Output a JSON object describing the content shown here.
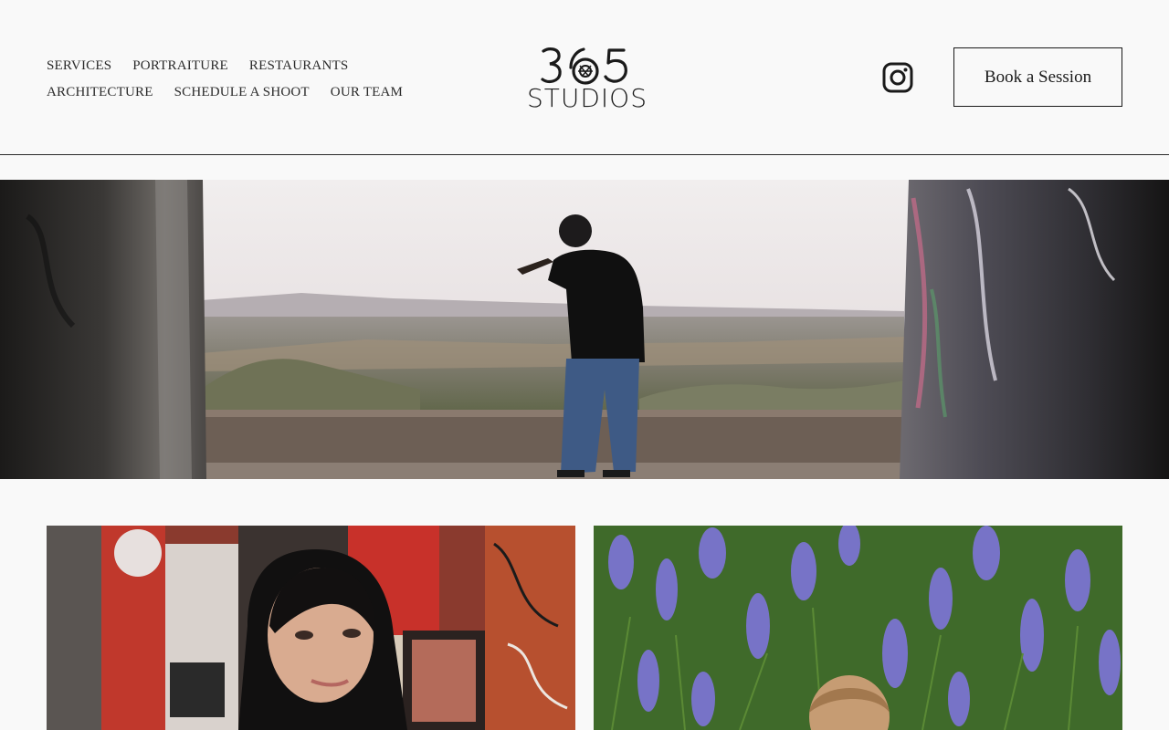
{
  "nav": {
    "row1": [
      "SERVICES",
      "PORTRAITURE",
      "RESTAURANTS"
    ],
    "row2": [
      "ARCHITECTURE",
      "SCHEDULE A SHOOT",
      "OUR TEAM"
    ]
  },
  "logo": {
    "number": "365",
    "word": "STUDIOS"
  },
  "social": {
    "icon": "instagram-icon"
  },
  "cta": {
    "label": "Book a Session"
  },
  "colors": {
    "background": "#f9f9f9",
    "text": "#1a1a1a",
    "divider": "#2a2a2a"
  }
}
